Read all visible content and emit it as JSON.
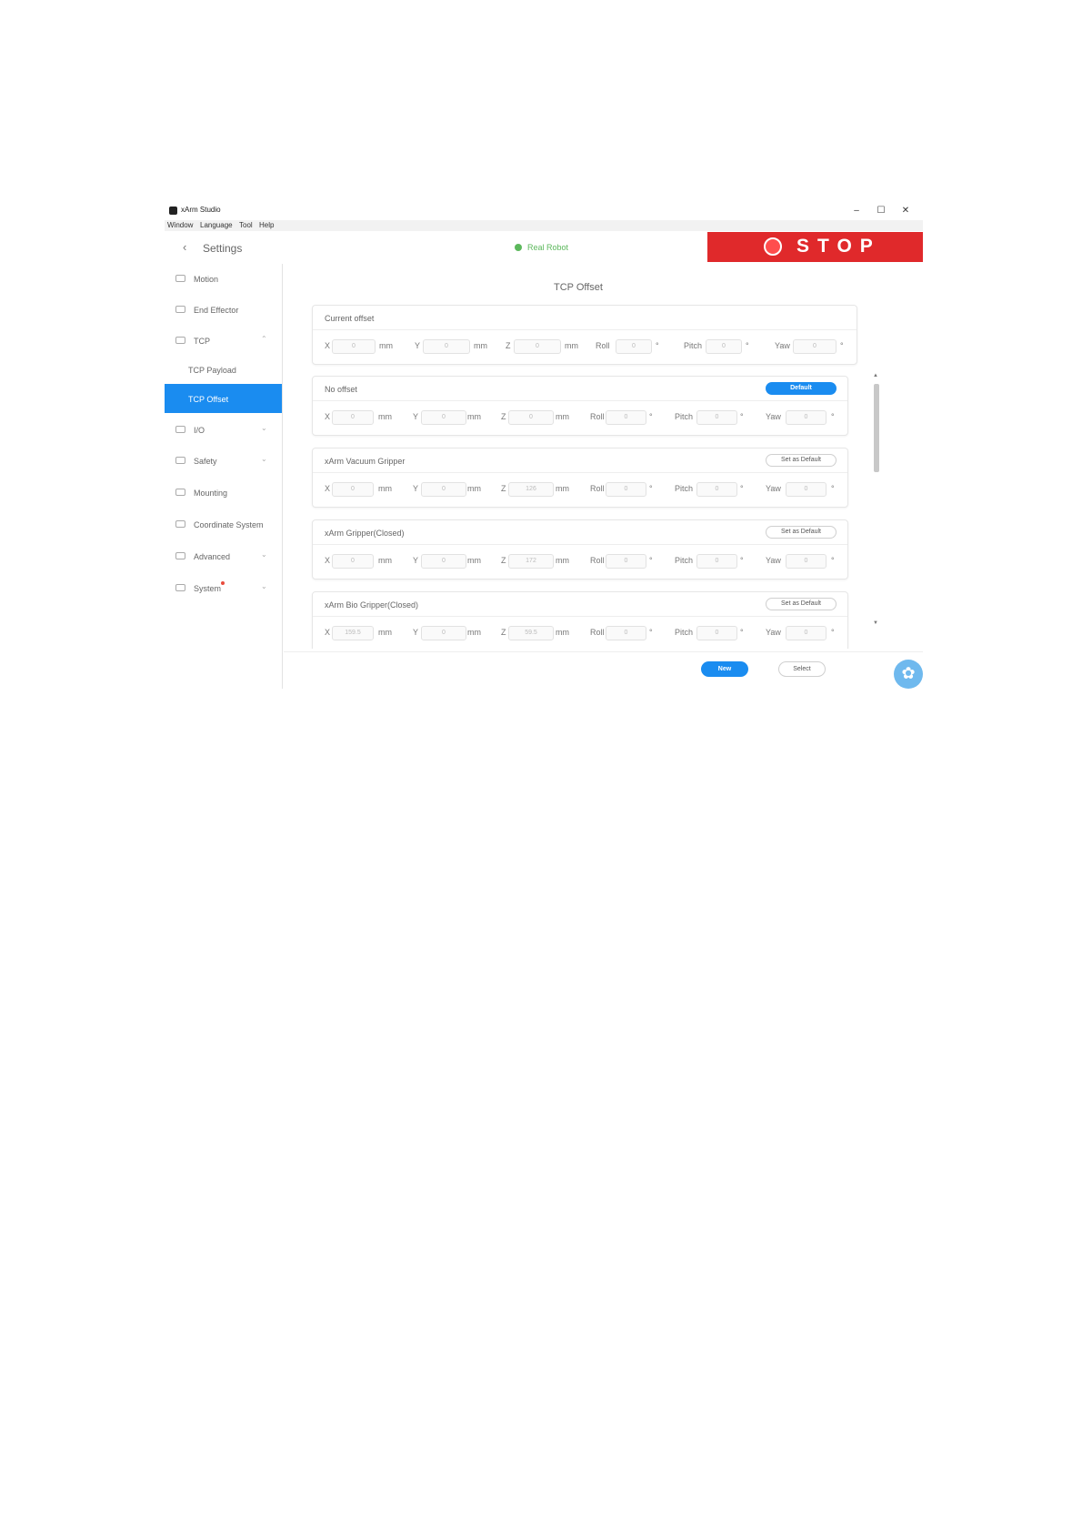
{
  "app": {
    "title": "xArm Studio",
    "window_controls": {
      "minimize": "–",
      "maximize": "☐",
      "close": "✕"
    }
  },
  "menu": [
    "Window",
    "Language",
    "Tool",
    "Help"
  ],
  "header": {
    "back_icon": "‹",
    "title": "Settings",
    "status": "Real Robot",
    "status_color": "#5cb85c",
    "stop_label": "STOP",
    "stop_color": "#e0292b"
  },
  "sidebar": {
    "items": [
      {
        "label": "Motion",
        "icon": "motion-icon"
      },
      {
        "label": "End Effector",
        "icon": "end-effector-icon"
      },
      {
        "label": "TCP",
        "icon": "tcp-icon",
        "chevron": "⌃"
      },
      {
        "label": "TCP Payload"
      },
      {
        "label": "TCP Offset",
        "active": true
      },
      {
        "label": "I/O",
        "icon": "io-icon",
        "chevron": "⌄"
      },
      {
        "label": "Safety",
        "icon": "safety-icon",
        "chevron": "⌄"
      },
      {
        "label": "Mounting",
        "icon": "mounting-icon"
      },
      {
        "label": "Coordinate System",
        "icon": "coordinate-icon"
      },
      {
        "label": "Advanced",
        "icon": "advanced-icon",
        "chevron": "⌄"
      },
      {
        "label": "System",
        "icon": "system-icon",
        "chevron": "⌄",
        "notification_dot": true
      }
    ]
  },
  "main": {
    "title": "TCP Offset",
    "field_labels": {
      "x": "X",
      "y": "Y",
      "z": "Z",
      "roll": "Roll",
      "pitch": "Pitch",
      "yaw": "Yaw"
    },
    "units": {
      "length": "mm",
      "angle": "°"
    },
    "current": {
      "title": "Current offset",
      "values": {
        "x": "0",
        "y": "0",
        "z": "0",
        "roll": "0",
        "pitch": "0",
        "yaw": "0"
      }
    },
    "presets": [
      {
        "title": "No offset",
        "button": "Default",
        "primary": true,
        "values": {
          "x": "0",
          "y": "0",
          "z": "0",
          "roll": "0",
          "pitch": "0",
          "yaw": "0"
        }
      },
      {
        "title": "xArm Vacuum Gripper",
        "button": "Set as Default",
        "values": {
          "x": "0",
          "y": "0",
          "z": "126",
          "roll": "0",
          "pitch": "0",
          "yaw": "0"
        }
      },
      {
        "title": "xArm Gripper(Closed)",
        "button": "Set as Default",
        "values": {
          "x": "0",
          "y": "0",
          "z": "172",
          "roll": "0",
          "pitch": "0",
          "yaw": "0"
        }
      },
      {
        "title": "xArm Bio Gripper(Closed)",
        "button": "Set as Default",
        "values": {
          "x": "159.5",
          "y": "0",
          "z": "59.5",
          "roll": "0",
          "pitch": "0",
          "yaw": "0"
        }
      }
    ],
    "scroll": {
      "up": "▲",
      "down": "▼"
    }
  },
  "footer": {
    "new": "New",
    "select": "Select",
    "gear_icon": "✿"
  }
}
